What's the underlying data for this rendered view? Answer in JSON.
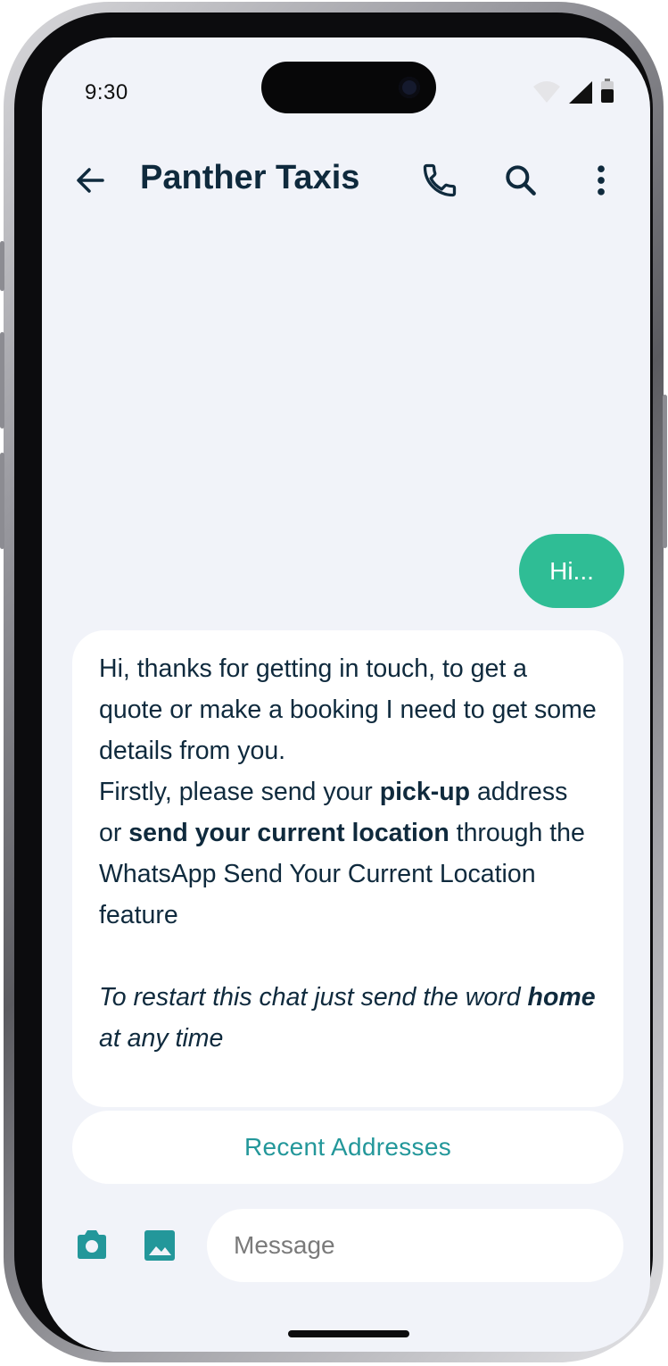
{
  "status_bar": {
    "time": "9:30",
    "icons": [
      "wifi-icon",
      "cellular-signal-icon",
      "battery-icon"
    ]
  },
  "header": {
    "title": "Panther Taxis",
    "icons": [
      "back-arrow-icon",
      "phone-icon",
      "search-icon",
      "more-vertical-icon"
    ]
  },
  "messages": {
    "outgoing": {
      "text": "Hi..."
    },
    "incoming": {
      "line1": "Hi, thanks for getting in touch, to get a quote or make a booking I need to get some details from you.",
      "line2_pre": "Firstly, please send your ",
      "line2_bold1": "pick-up",
      "line2_mid": " address or ",
      "line2_bold2": "send your current location",
      "line2_post": " through the",
      "line3": "WhatsApp Send Your Current Location feature",
      "italic_pre": "To restart this chat just send the word ",
      "italic_bold": "home",
      "italic_post": " at any time"
    }
  },
  "quick_reply": {
    "label": "Recent Addresses"
  },
  "composer": {
    "placeholder": "Message",
    "icons": [
      "camera-icon",
      "image-icon"
    ]
  },
  "colors": {
    "accent_green": "#2fbd95",
    "accent_teal": "#23979a",
    "text_dark": "#0f2a3d",
    "screen_bg": "#f1f3f9"
  }
}
